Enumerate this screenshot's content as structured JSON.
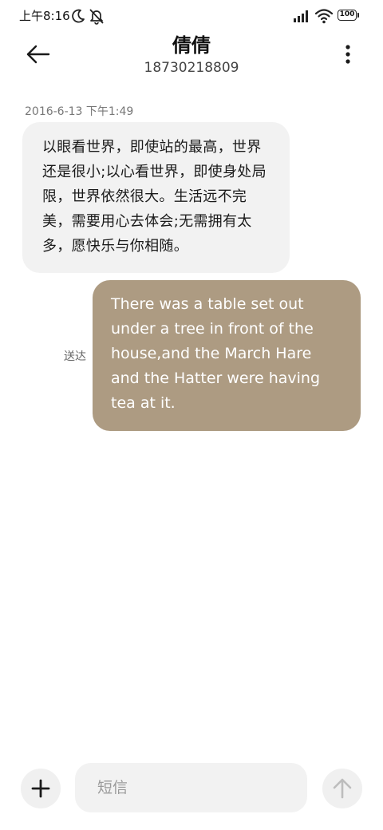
{
  "status_bar": {
    "time": "上午8:16",
    "battery": "100",
    "icons": [
      "moon-icon",
      "mute-bell-icon",
      "signal-icon",
      "wifi-icon",
      "battery-icon"
    ]
  },
  "header": {
    "contact_name": "倩倩",
    "contact_number": "18730218809",
    "back_icon": "arrow-left-icon",
    "more_icon": "more-vertical-icon"
  },
  "conversation": {
    "timestamp": "2016-6-13 下午1:49",
    "messages": [
      {
        "direction": "incoming",
        "text": "以眼看世界，即使站的最高，世界还是很小;以心看世界，即使身处局限，世界依然很大。生活远不完美，需要用心去体会;无需拥有太多，愿快乐与你相随。"
      },
      {
        "direction": "outgoing",
        "text": "There was a table set out under a tree in front of the house,and the March Hare and the Hatter were having tea at it.",
        "status": "送达"
      }
    ]
  },
  "composer": {
    "placeholder": "短信",
    "add_icon": "plus-icon",
    "send_icon": "arrow-up-icon"
  },
  "colors": {
    "outgoing_bubble": "#ad9b82",
    "incoming_bubble": "#f2f2f2",
    "input_background": "#f2f2f2",
    "send_icon": "#bdbdbd"
  }
}
